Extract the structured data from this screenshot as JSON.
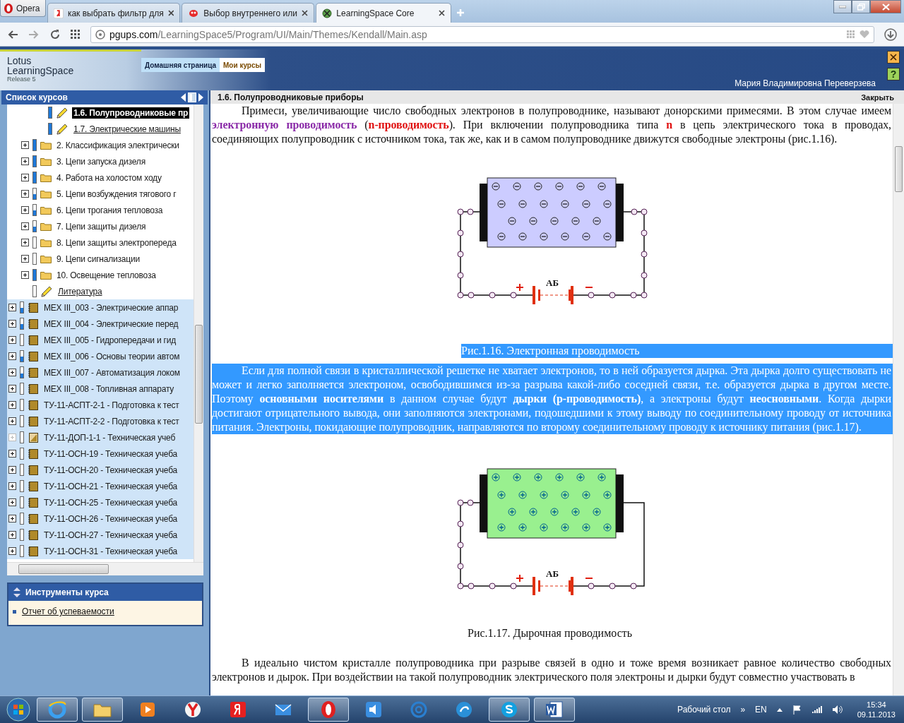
{
  "browser": {
    "menu_button": "Opera",
    "url_host": "pgups.com",
    "url_path": "/LearningSpace5/Program/UI/Main/Themes/Kendall/Main.asp",
    "tabs": [
      {
        "kind": "yandex",
        "title": "как выбрать фильтр для",
        "selected": false
      },
      {
        "kind": "bug",
        "title": "Выбор внутреннего или",
        "selected": false
      },
      {
        "kind": "globe",
        "title": "LearningSpace Core",
        "selected": true
      }
    ]
  },
  "header": {
    "logo_line1": "Lotus",
    "logo_line2": "LearningSpace",
    "logo_release": "Release 5",
    "user": "Мария Владимировна Переверзева",
    "help_button": "?",
    "nav": [
      {
        "label": "Домашняя страница",
        "selected": false
      },
      {
        "label": "Мои курсы",
        "selected": true
      }
    ]
  },
  "sidebar": {
    "title": "Список курсов",
    "tools_title": "Инструменты курса",
    "tools_links": [
      "Отчет об успеваемости"
    ],
    "lessons": [
      {
        "label": "1.6. Полупроводниковые пр",
        "selected": true,
        "level": 1
      },
      {
        "label": "1.7. Электрические машины",
        "selected": false,
        "level": 1
      }
    ],
    "chapters": [
      {
        "kind": "folder",
        "label": "2. Классификация электрически",
        "level": 1
      },
      {
        "kind": "folder",
        "label": "3. Цепи запуска дизеля",
        "level": 1
      },
      {
        "kind": "folder",
        "label": "4. Работа на холостом ходу",
        "level": 1
      },
      {
        "kind": "folder",
        "label": "5. Цепи возбуждения тягового г",
        "level": 0.5
      },
      {
        "kind": "folder",
        "label": "6. Цепи трогания тепловоза",
        "level": 0.5
      },
      {
        "kind": "folder",
        "label": "7. Цепи защиты дизеля",
        "level": 0.5
      },
      {
        "kind": "folder",
        "label": "8. Цепи защиты электропереда",
        "level": 0
      },
      {
        "kind": "folder",
        "label": "9. Цепи сигнализации",
        "level": 0
      },
      {
        "kind": "folder",
        "label": "10. Освещение тепловоза",
        "level": 1
      },
      {
        "kind": "lesson",
        "label": "Литература",
        "level": 0
      }
    ],
    "courses": [
      {
        "label": "МЕХ III_003 - Электрические аппар",
        "level": 0.5,
        "disabled": false
      },
      {
        "label": "МЕХ III_004 - Электрические перед",
        "level": 0.5,
        "disabled": false
      },
      {
        "label": "МЕХ III_005 - Гидропередачи и гид",
        "level": 0,
        "disabled": false
      },
      {
        "label": "МЕХ III_006 - Основы теории автом",
        "level": 0.5,
        "disabled": false
      },
      {
        "label": "МЕХ III_007 - Автоматизация локом",
        "level": 0.4,
        "disabled": false
      },
      {
        "label": "МЕХ III_008 - Топливная аппарату",
        "level": 0,
        "disabled": false
      },
      {
        "label": "ТУ-11-АСПТ-2-1 - Подготовка к тест",
        "level": 0,
        "disabled": false
      },
      {
        "label": "ТУ-11-АСПТ-2-2 - Подготовка к тест",
        "level": 0,
        "disabled": false
      },
      {
        "label": "ТУ-11-ДОП-1-1 - Техническая учеб",
        "level": 0,
        "disabled": true
      },
      {
        "label": "ТУ-11-ОСН-19 - Техническая учеба",
        "level": 0,
        "disabled": false
      },
      {
        "label": "ТУ-11-ОСН-20 - Техническая учеба",
        "level": 0,
        "disabled": false
      },
      {
        "label": "ТУ-11-ОСН-21 - Техническая учеба",
        "level": 0,
        "disabled": false
      },
      {
        "label": "ТУ-11-ОСН-25 - Техническая учеба",
        "level": 0,
        "disabled": false
      },
      {
        "label": "ТУ-11-ОСН-26 - Техническая учеба",
        "level": 0,
        "disabled": false
      },
      {
        "label": "ТУ-11-ОСН-27 - Техническая учеба",
        "level": 0,
        "disabled": false
      },
      {
        "label": "ТУ-11-ОСН-31 - Техническая учеба",
        "level": 0,
        "disabled": false
      }
    ]
  },
  "document": {
    "title": "1.6. Полупроводниковые приборы",
    "close_link": "Закрыть",
    "blocks": [
      {
        "kind": "paragraph",
        "highlighted": false,
        "segments": [
          {
            "kind": "plain",
            "text": "Примеси, увеличивающие число свободных электронов в полупроводнике, называют донорскими примесями. В этом случае имеем "
          },
          {
            "kind": "term",
            "text": "электронную проводимость"
          },
          {
            "kind": "plain",
            "text": " ("
          },
          {
            "kind": "accent",
            "text": "n-проводимость"
          },
          {
            "kind": "plain",
            "text": "). При включении полупроводника типа "
          },
          {
            "kind": "accent",
            "text": "n"
          },
          {
            "kind": "plain",
            "text": " в цепь электрического тока в проводах, соединяющих полупроводник с источником тока, так же, как и в самом полупроводнике движутся свободные электроны (рис.1.16)."
          }
        ]
      },
      {
        "kind": "electron_figure",
        "battery_label": "АБ",
        "caption": "Рис.1.16. Электронная проводимость",
        "highlighted": true
      },
      {
        "kind": "paragraph",
        "highlighted": true,
        "segments": [
          {
            "kind": "plain",
            "text": "Если для полной связи в кристаллической решетке не хватает электронов, то в ней образуется дырка. Эта дырка долго существовать не может и легко заполняется электроном, освободившимся из-за разрыва какой-либо соседней связи, т.е. образуется дырка в другом месте. Поэтому "
          },
          {
            "kind": "bold",
            "text": "основными носителями"
          },
          {
            "kind": "plain",
            "text": " в данном случае будут "
          },
          {
            "kind": "bold",
            "text": "дырки (р-проводимость)"
          },
          {
            "kind": "plain",
            "text": ", а электроны будут "
          },
          {
            "kind": "bold",
            "text": "неосновными"
          },
          {
            "kind": "plain",
            "text": ". Когда дырки достигают отрицательного вывода, они заполняются электронами, подошедшими к этому выводу по соединительному проводу от источника питания. Электроны, покидающие полупроводник, направляются по второму соединительному проводу к источнику питания (рис.1.17)."
          }
        ]
      },
      {
        "kind": "hole_figure",
        "battery_label": "АБ",
        "caption": "Рис.1.17. Дырочная проводимость",
        "highlighted": false
      },
      {
        "kind": "paragraph",
        "highlighted": false,
        "segments": [
          {
            "kind": "plain",
            "text": "В идеально чистом кристалле полупроводника при разрыве связей в одно и тоже время возникает равное количество свободных электронов и дырок. При воздействии на такой полупроводник электрического поля электроны и дырки будут совместно участвовать в"
          }
        ]
      }
    ]
  },
  "taskbar": {
    "desktop_label": "Рабочий стол",
    "more": "»",
    "language": "EN",
    "time": "15:34",
    "date": "09.11.2013",
    "apps": [
      {
        "kind": "ie",
        "running": true
      },
      {
        "kind": "folder",
        "running": true
      },
      {
        "kind": "media",
        "running": false
      },
      {
        "kind": "yabrowser",
        "running": false
      },
      {
        "kind": "yandex",
        "running": false
      },
      {
        "kind": "mail",
        "running": false
      },
      {
        "kind": "opera",
        "running": true
      },
      {
        "kind": "speaker",
        "running": false
      },
      {
        "kind": "at",
        "running": false
      },
      {
        "kind": "bird",
        "running": false
      },
      {
        "kind": "skype",
        "running": true
      },
      {
        "kind": "word",
        "running": true
      }
    ]
  }
}
